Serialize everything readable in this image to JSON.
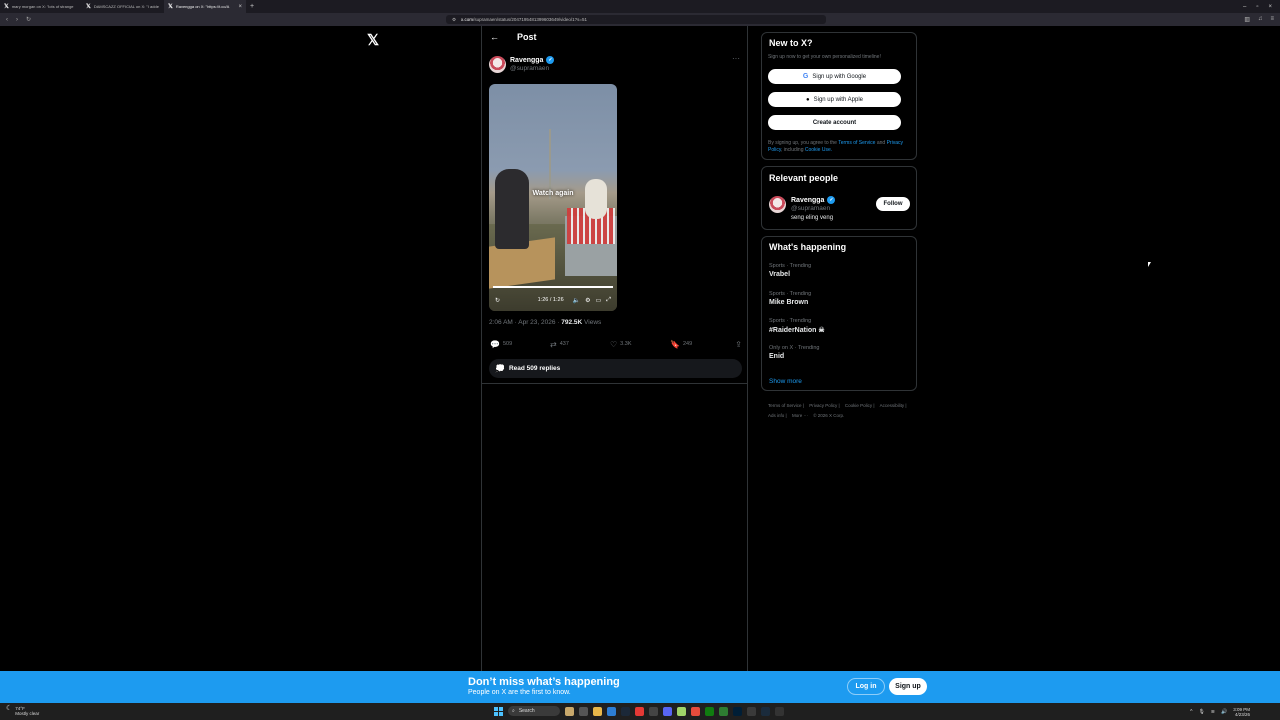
{
  "browser": {
    "tabs": [
      {
        "label": "mary morgan on X: \"lots of strange"
      },
      {
        "label": "DAMSCAZZ OFFICIAL on X: \"I adde"
      },
      {
        "label": "Ravengga on X: \"https://t.co/A"
      }
    ],
    "url_domain": "x.com",
    "url_path": "/supramaen/status/2047195481399603649/video/1?s=51"
  },
  "post": {
    "header_title": "Post",
    "author_name": "Ravengga",
    "author_handle": "@supramaen",
    "video_overlay": "Watch again",
    "video_time": "1:26 / 1:26",
    "timestamp": "2:06 AM · Apr 23, 2026 · ",
    "views_count": "792.5K",
    "views_label": " Views",
    "replies": "509",
    "reposts": "437",
    "likes": "3.3K",
    "bookmarks": "249",
    "read_replies": "Read 509 replies"
  },
  "signup_card": {
    "title": "New to X?",
    "subtitle": "Sign up now to get your own personalized timeline!",
    "google_label": "Sign up with Google",
    "apple_label": "Sign up with Apple",
    "create_label": "Create account",
    "terms_prefix": "By signing up, you agree to the ",
    "terms_link": "Terms of Service",
    "terms_and": " and ",
    "privacy_link": "Privacy Policy",
    "including": ", including ",
    "cookie_link": "Cookie Use."
  },
  "relevant": {
    "title": "Relevant people",
    "name": "Ravengga",
    "handle": "@supramaen",
    "bio": "seng eling veng",
    "follow_label": "Follow"
  },
  "trending": {
    "title": "What's happening",
    "items": [
      {
        "category": "Sports · Trending",
        "name": "Vrabel"
      },
      {
        "category": "Sports · Trending",
        "name": "Mike Brown"
      },
      {
        "category": "Sports · Trending",
        "name": "#RaiderNation ☠"
      },
      {
        "category": "Only on X · Trending",
        "name": "Enid"
      }
    ],
    "show_more": "Show more"
  },
  "footer": {
    "links": [
      "Terms of Service |",
      "Privacy Policy |",
      "Cookie Policy |",
      "Accessibility |",
      "Ads info |",
      "More ···",
      "© 2026 X Corp."
    ]
  },
  "banner": {
    "headline": "Don’t miss what’s happening",
    "subline": "People on X are the first to know.",
    "login": "Log in",
    "signup": "Sign up"
  },
  "taskbar": {
    "weather_temp": "74°F",
    "weather_desc": "Mostly clear",
    "search_label": "Search",
    "time": "3:09 PM",
    "date": "4/23/26"
  },
  "colors": {
    "accent": "#1d9bf0",
    "background": "#000000",
    "border": "#2f3336"
  }
}
